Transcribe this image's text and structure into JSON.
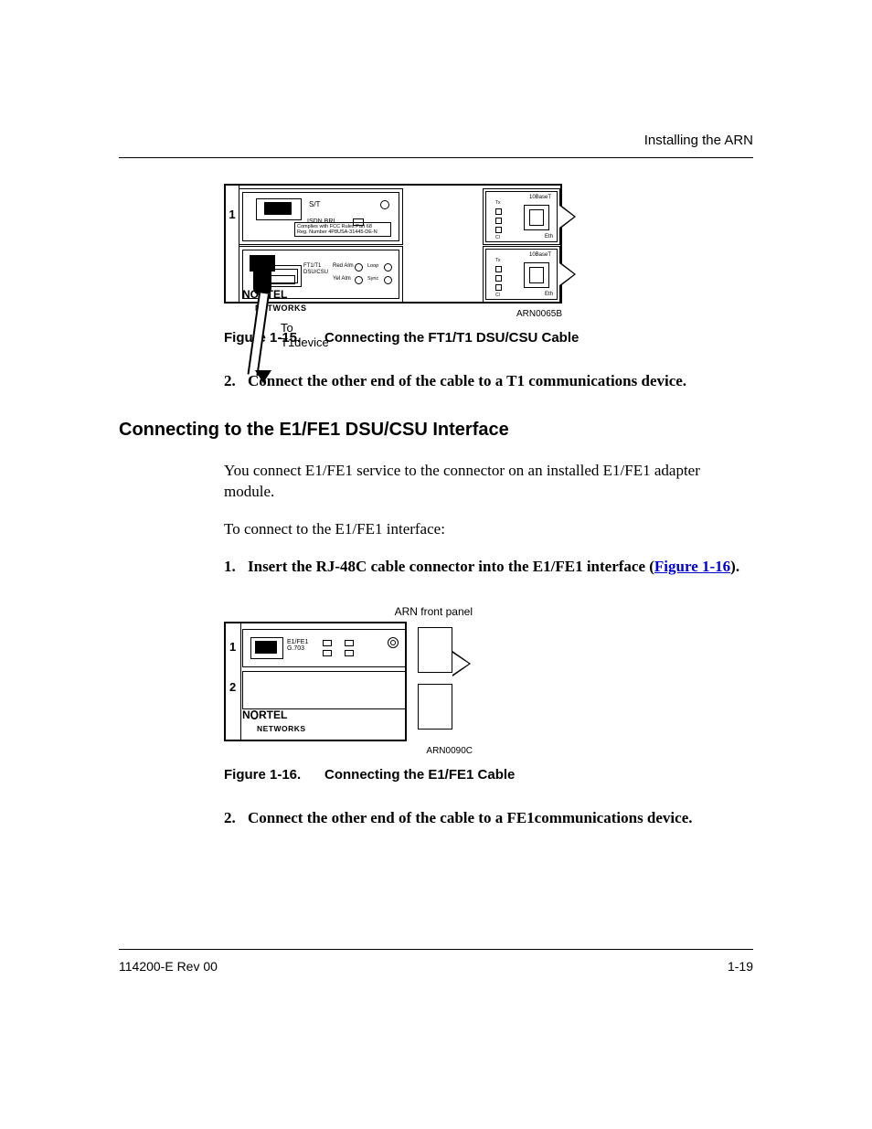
{
  "header": {
    "running": "Installing the ARN"
  },
  "fig15": {
    "id": "ARN0065B",
    "caption_num": "Figure 1-15.",
    "caption": "Connecting the FT1/T1 DSU/CSU Cable",
    "labels": {
      "st": "S/T",
      "isdn": "ISDN BRI",
      "fcc1": "Complies with FCC Rules Part 68",
      "fcc2": "Reg. Number 4P8USA-31445-DE-N",
      "ft1": "FT1/T1\nDSU/CSU",
      "redalm": "Red Alm",
      "yelalm": "Yel Alm",
      "loop": "Loop",
      "sync": "Sync",
      "tenb": "10BaseT",
      "eth": "Eth",
      "tx": "Tx",
      "cl": "Cl",
      "logo1": "NORTEL",
      "logo2": "NETWORKS",
      "to": "To\nT1device",
      "slot1": "1"
    }
  },
  "step2a": {
    "num": "2.",
    "text": "Connect the other end of the cable to a T1 communications device."
  },
  "h2": "Connecting to the E1/FE1 DSU/CSU Interface",
  "p1": "You connect E1/FE1 service to the connector on an installed E1/FE1 adapter module.",
  "p2": "To connect to the E1/FE1 interface:",
  "step1": {
    "num": "1.",
    "text_a": "Insert the RJ-48C cable connector into the E1/FE1 interface (",
    "link": "Figure 1-16",
    "text_b": ")."
  },
  "fig16": {
    "toplabel": "ARN front panel",
    "id": "ARN0090C",
    "caption_num": "Figure 1-16.",
    "caption": "Connecting the E1/FE1 Cable",
    "labels": {
      "slot1": "1",
      "slot2": "2",
      "e1": "E1/FE1\nG.703",
      "logo1": "NORTEL",
      "logo2": "NETWORKS"
    }
  },
  "step2b": {
    "num": "2.",
    "text": "Connect the other end of the cable to a FE1communications device."
  },
  "footer": {
    "left": "114200-E Rev 00",
    "right": "1-19"
  }
}
